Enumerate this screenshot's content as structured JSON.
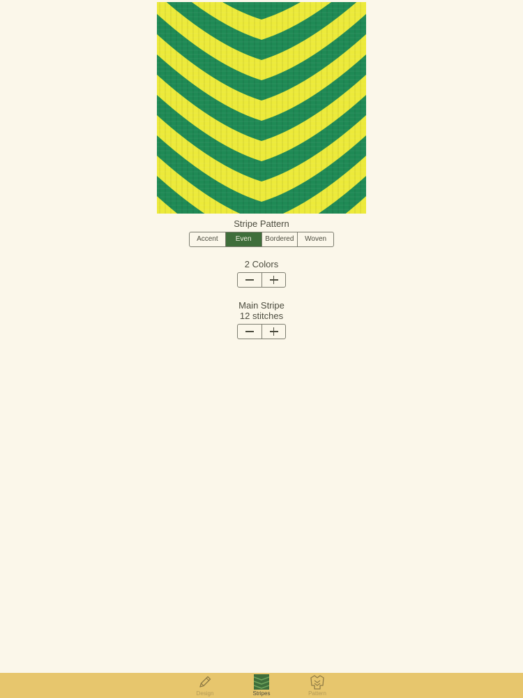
{
  "colors": {
    "background": "#fbf7ea",
    "accent": "#3f6e3b",
    "stripe_green": "#1f8a55",
    "stripe_yellow": "#ecea3a",
    "tabbar": "#e7c66d"
  },
  "preview": {
    "image": "knitted-chevron-stripes",
    "stripe_colors": [
      "#1f8a55",
      "#ecea3a"
    ]
  },
  "stripe_pattern": {
    "title": "Stripe Pattern",
    "options": [
      "Accent",
      "Even",
      "Bordered",
      "Woven"
    ],
    "selected": "Even"
  },
  "colors_count": {
    "label": "2 Colors",
    "decrement_icon": "minus-icon",
    "increment_icon": "plus-icon"
  },
  "main_stripe": {
    "title": "Main Stripe",
    "value": "12 stitches",
    "decrement_icon": "minus-icon",
    "increment_icon": "plus-icon"
  },
  "tabbar": {
    "tabs": [
      {
        "label": "Design",
        "icon": "pencil-icon",
        "active": false
      },
      {
        "label": "Stripes",
        "icon": "stripes-icon",
        "active": true
      },
      {
        "label": "Pattern",
        "icon": "sweater-icon",
        "active": false
      }
    ]
  }
}
